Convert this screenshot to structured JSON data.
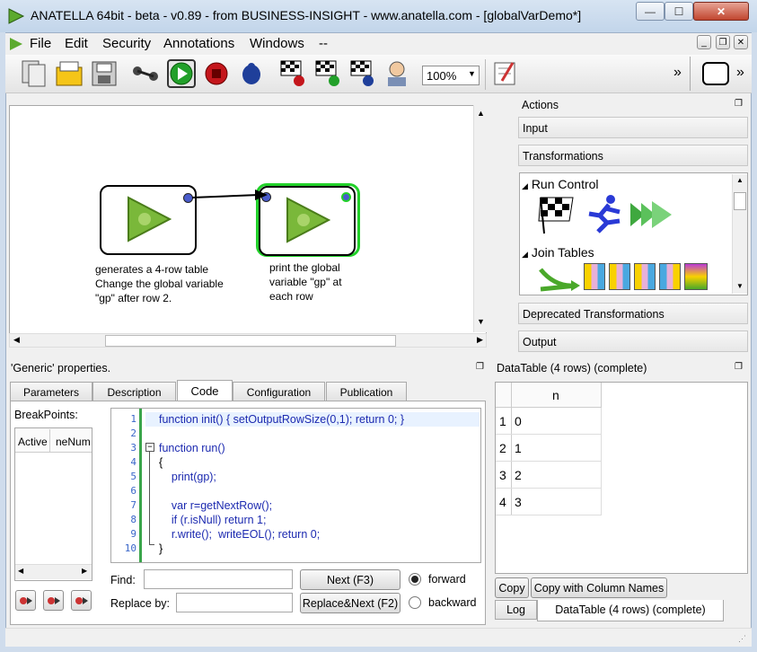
{
  "window": {
    "title": "ANATELLA 64bit - beta - v0.89 - from BUSINESS-INSIGHT - www.anatella.com - [globalVarDemo*]",
    "minimize": "—",
    "maximize": "☐",
    "close": "✕"
  },
  "menu": {
    "items": [
      "File",
      "Edit",
      "Security",
      "Annotations",
      "Windows",
      "--"
    ],
    "mdi_min": "_",
    "mdi_restore": "❐",
    "mdi_close": "✕"
  },
  "toolbar": {
    "zoom": "100%",
    "overflow": "»",
    "overflow2": "»"
  },
  "canvas": {
    "node1_label": "generates a 4-row table\nChange the global variable\n\"gp\" after row 2.",
    "node2_label": "print the global\nvariable \"gp\" at\neach row"
  },
  "actions": {
    "title": "Actions",
    "groups": {
      "input": "Input",
      "transformations": "Transformations",
      "deprecated": "Deprecated Transformations",
      "output": "Output"
    },
    "sections": {
      "run_control": "Run Control",
      "join_tables": "Join Tables"
    }
  },
  "properties": {
    "title": "'Generic' properties.",
    "tabs": [
      "Parameters",
      "Description",
      "Code",
      "Configuration",
      "Publication"
    ],
    "active_tab": "Code",
    "breakpoints_label": "BreakPoints:",
    "bp_columns": [
      "Active",
      "neNum"
    ],
    "code_lines": [
      "function init() { setOutputRowSize(0,1); return 0; }",
      "",
      "function run()",
      "{",
      "    print(gp);",
      "",
      "    var r=getNextRow();",
      "    if (r.isNull) return 1;",
      "    r.write();  writeEOL(); return 0;",
      "}"
    ],
    "line_numbers": [
      "1",
      "2",
      "3",
      "4",
      "5",
      "6",
      "7",
      "8",
      "9",
      "10"
    ],
    "find_label": "Find:",
    "replace_label": "Replace by:",
    "next_button": "Next (F3)",
    "replace_next_button": "Replace&Next (F2)",
    "forward_label": "forward",
    "backward_label": "backward"
  },
  "datatable": {
    "title": "DataTable (4 rows) (complete)",
    "column": "n",
    "rows": [
      {
        "index": "1",
        "n": "0"
      },
      {
        "index": "2",
        "n": "1"
      },
      {
        "index": "3",
        "n": "2"
      },
      {
        "index": "4",
        "n": "3"
      }
    ],
    "copy_button": "Copy",
    "copy_with_names_button": "Copy with Column Names",
    "bottom_tabs": [
      "Log",
      "DataTable (4 rows) (complete)"
    ]
  }
}
